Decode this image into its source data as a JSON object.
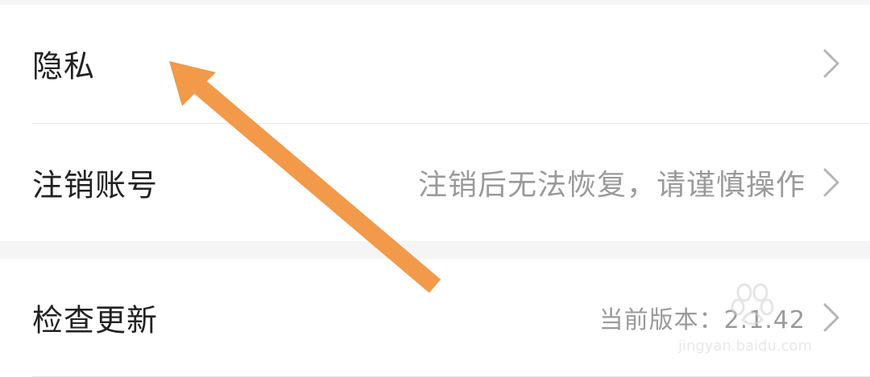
{
  "settings": {
    "group1": {
      "privacy": {
        "label": "隐私"
      },
      "delete_account": {
        "label": "注销账号",
        "hint": "注销后无法恢复，请谨慎操作"
      }
    },
    "group2": {
      "check_update": {
        "label": "检查更新",
        "value": "当前版本：2.1.42"
      }
    }
  },
  "icons": {
    "chevron": "chevron-right-icon"
  },
  "colors": {
    "background": "#f5f5f5",
    "card": "#ffffff",
    "label": "#222222",
    "secondary": "#9a9a9a",
    "chevron": "#b5b5b5",
    "annotation_arrow": "#f2994a"
  },
  "watermark": {
    "text": "jingyan.baidu.com"
  }
}
